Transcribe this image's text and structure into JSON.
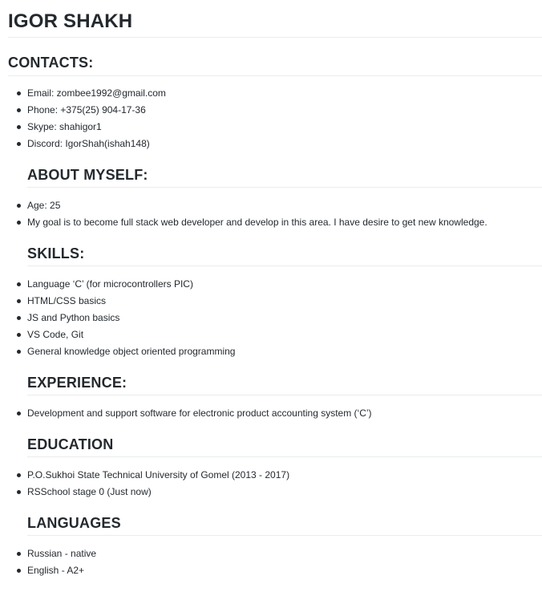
{
  "name": "IGOR SHAKH",
  "contacts": {
    "heading": "CONTACTS:",
    "items": [
      "Email: zombee1992@gmail.com",
      "Phone: +375(25) 904-17-36",
      "Skype: shahigor1",
      "Discord: IgorShah(ishah148)"
    ]
  },
  "about": {
    "heading": "ABOUT MYSELF:",
    "items": [
      "Age: 25",
      "My goal is to become full stack web developer and develop in this area. I have desire to get new knowledge."
    ]
  },
  "skills": {
    "heading": "SKILLS:",
    "items": [
      "Language ‘C’ (for microcontrollers PIC)",
      "HTML/CSS basics",
      "JS and Python basics",
      "VS Code, Git",
      "General knowledge object oriented programming"
    ]
  },
  "experience": {
    "heading": "EXPERIENCE:",
    "items": [
      "Development and support software for electronic product accounting system (‘C’)"
    ]
  },
  "education": {
    "heading": "EDUCATION",
    "items": [
      "P.O.Sukhoi State Technical University of Gomel (2013 - 2017)",
      "RSSchool stage 0 (Just now)"
    ]
  },
  "languages": {
    "heading": "LANGUAGES",
    "items": [
      "Russian - native",
      "English - A2+"
    ]
  }
}
